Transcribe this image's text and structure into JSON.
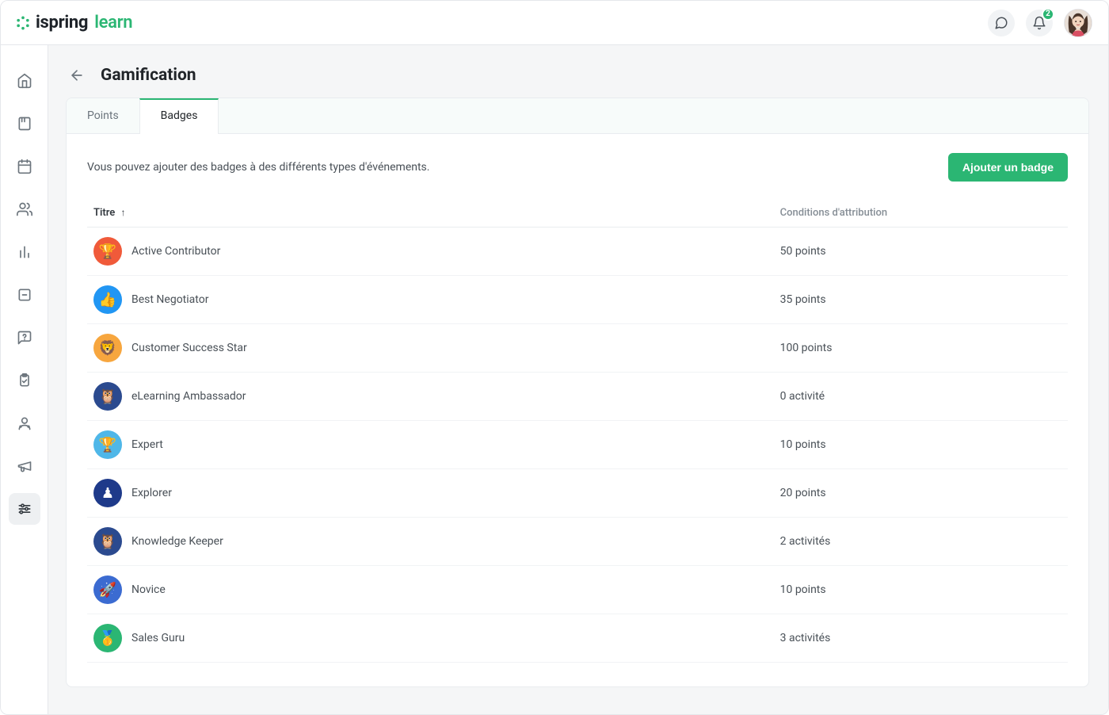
{
  "brand": {
    "name1": "ispring",
    "name2": "learn"
  },
  "notifications": {
    "count": "2"
  },
  "page": {
    "title": "Gamification",
    "tabs": [
      {
        "id": "points",
        "label": "Points"
      },
      {
        "id": "badges",
        "label": "Badges"
      }
    ],
    "activeTab": "badges",
    "intro": "Vous pouvez ajouter des badges à des différents types d'événements.",
    "addButton": "Ajouter un badge",
    "table": {
      "headers": {
        "title": "Titre",
        "condition": "Conditions d'attribution"
      }
    }
  },
  "badges": [
    {
      "title": "Active Contributor",
      "condition": "50 points",
      "bg": "#f05a3a",
      "glyph": "🏆"
    },
    {
      "title": "Best Negotiator",
      "condition": "35 points",
      "bg": "#2196f3",
      "glyph": "👍"
    },
    {
      "title": "Customer Success Star",
      "condition": "100 points",
      "bg": "#f7a63e",
      "glyph": "🦁"
    },
    {
      "title": "eLearning Ambassador",
      "condition": "0 activité",
      "bg": "#2b4a8f",
      "glyph": "🦉"
    },
    {
      "title": "Expert",
      "condition": "10 points",
      "bg": "#4fb7e8",
      "glyph": "🏆"
    },
    {
      "title": "Explorer",
      "condition": "20 points",
      "bg": "#1e3a8a",
      "glyph": "♟"
    },
    {
      "title": "Knowledge Keeper",
      "condition": "2 activités",
      "bg": "#2b4a8f",
      "glyph": "🦉"
    },
    {
      "title": "Novice",
      "condition": "10 points",
      "bg": "#3b6bd1",
      "glyph": "🚀"
    },
    {
      "title": "Sales Guru",
      "condition": "3 activités",
      "bg": "#2bb673",
      "glyph": "🥇"
    }
  ]
}
